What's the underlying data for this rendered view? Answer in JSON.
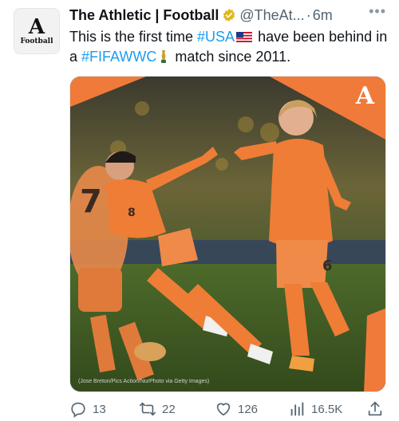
{
  "account": {
    "display_name": "The Athletic | Football",
    "handle": "@TheAt...",
    "separator": "·",
    "time": "6m",
    "more_label": "•••",
    "avatar": {
      "logo_letter": "A",
      "logo_text": "Football"
    }
  },
  "tweet": {
    "text_part1": "This is the first time ",
    "hashtag1": "#USA",
    "text_part2": " have been behind in a ",
    "hashtag2": "#FIFAWWC",
    "text_part3": " match since 2011."
  },
  "media": {
    "credit": "(Jose Breton/Pics Action/NurPhoto via Getty Images)",
    "watermark_letter": "A",
    "accent_color": "#f07a3a",
    "jersey_numbers": [
      "7",
      "8",
      "6"
    ]
  },
  "actions": {
    "replies": "13",
    "retweets": "22",
    "likes": "126",
    "views": "16.5K"
  },
  "colors": {
    "link": "#1d9bf0",
    "secondary_text": "#536471",
    "verified_badge": "#e2b719"
  }
}
